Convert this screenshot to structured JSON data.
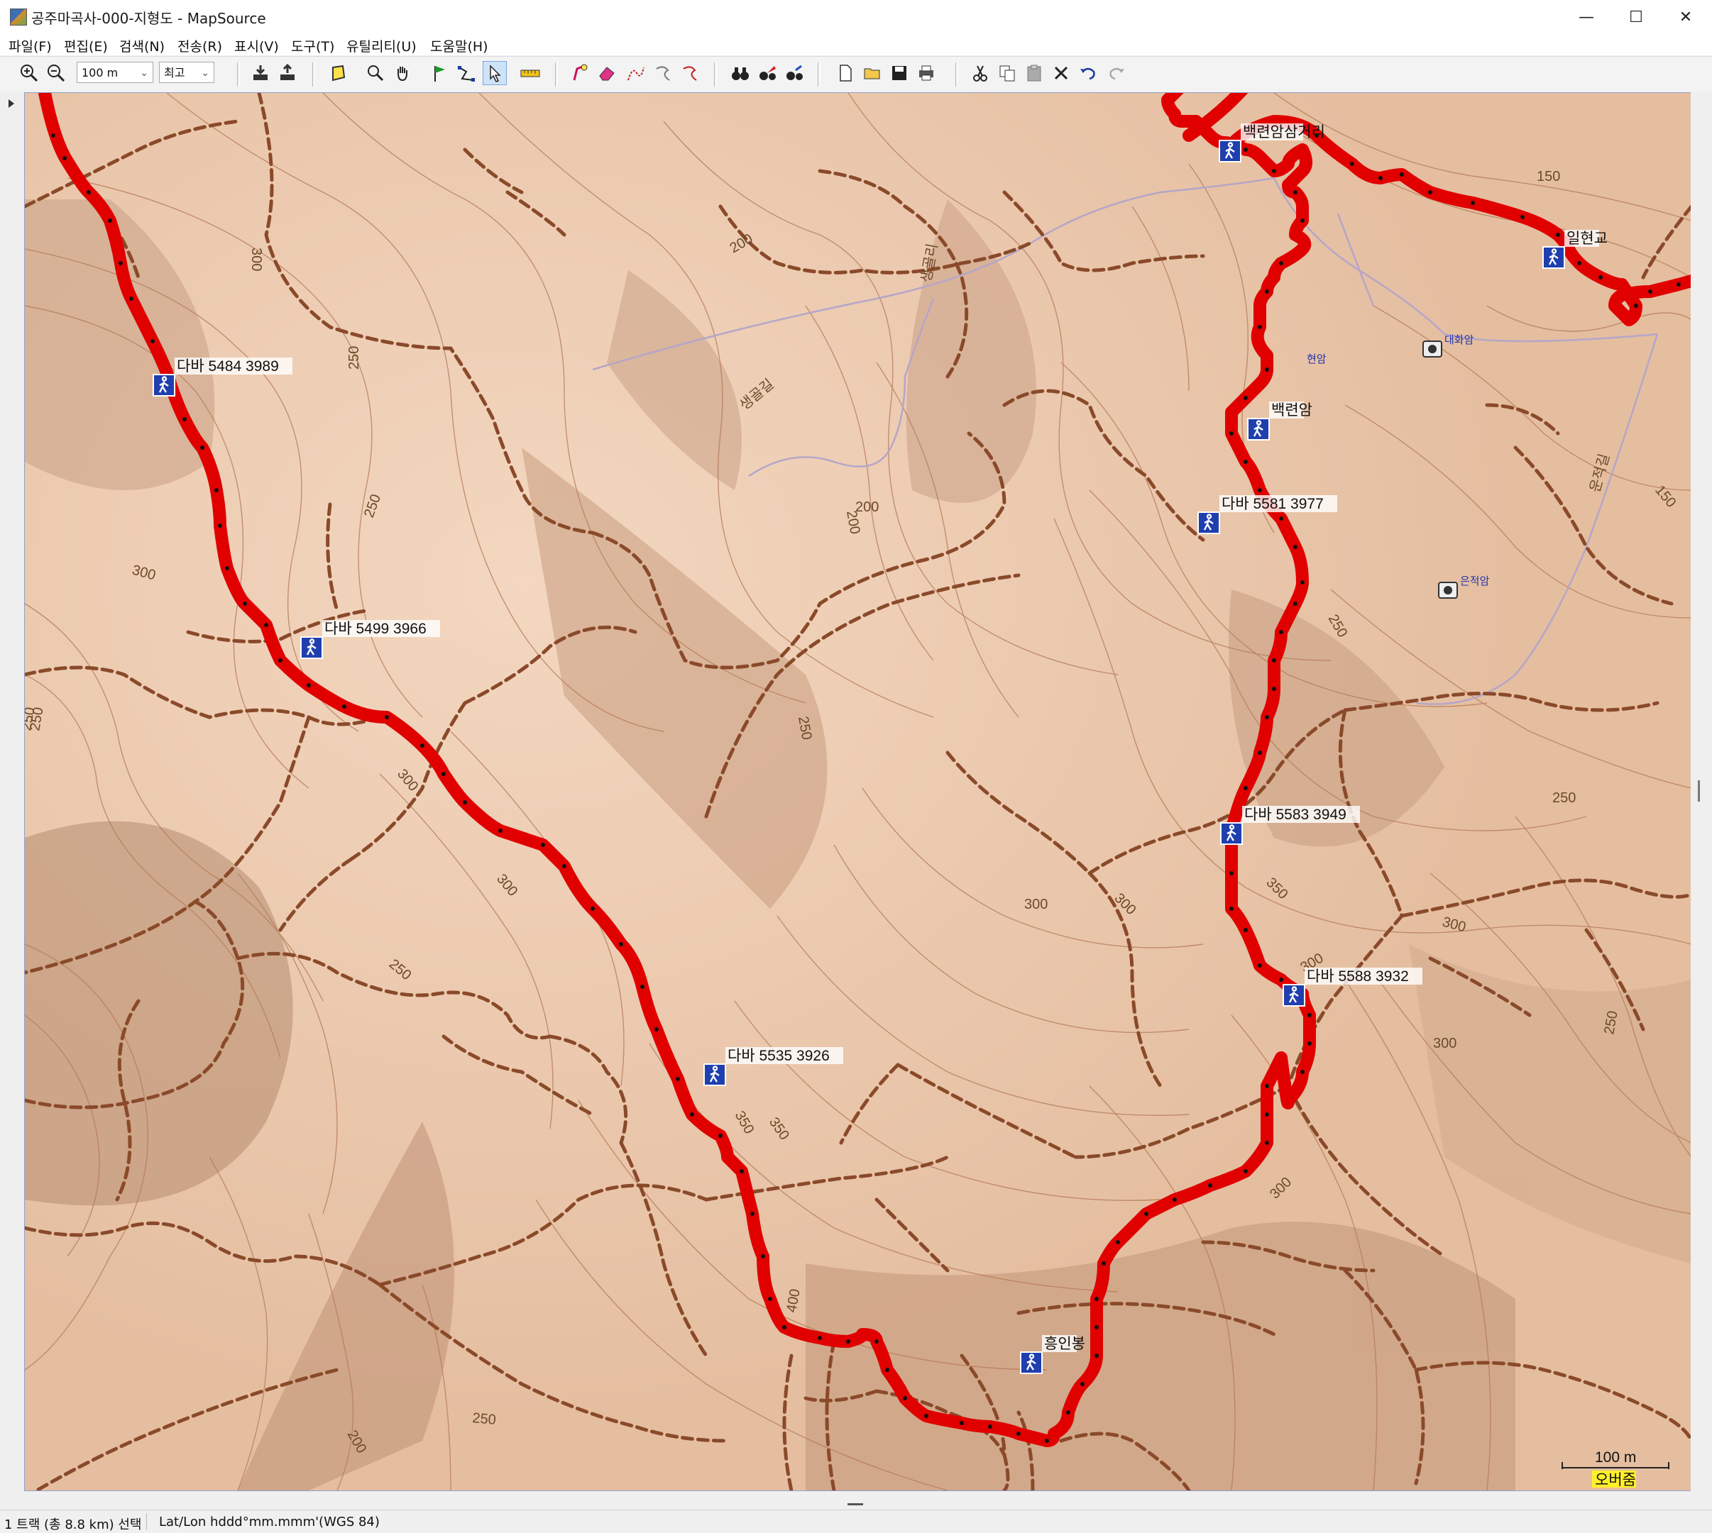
{
  "window": {
    "title": "공주마곡사-000-지형도 - MapSource",
    "minimize": "—",
    "maximize": "☐",
    "close": "✕"
  },
  "menu": [
    "파일(F)",
    "편집(E)",
    "검색(N)",
    "전송(R)",
    "표시(V)",
    "도구(T)",
    "유틸리티(U)",
    "도움말(H)"
  ],
  "toolbar": {
    "zoom_level": "100 m",
    "detail_level": "최고"
  },
  "map": {
    "waypoints": [
      {
        "label": "다바 5484 3989",
        "icon": "hiker-icon"
      },
      {
        "label": "다바 5499 3966",
        "icon": "hiker-icon"
      },
      {
        "label": "다바 5535 3926",
        "icon": "hiker-icon"
      },
      {
        "label": "흥인봉",
        "icon": "hiker-icon"
      },
      {
        "label": "다바 5588 3932",
        "icon": "hiker-icon"
      },
      {
        "label": "다바 5583 3949",
        "icon": "hiker-icon"
      },
      {
        "label": "다바 5581 3977",
        "icon": "hiker-icon"
      },
      {
        "label": "백련암",
        "icon": "hiker-icon"
      },
      {
        "label": "백련암삼거리",
        "icon": "hiker-icon"
      },
      {
        "label": "일현교",
        "icon": "hiker-icon"
      }
    ],
    "contour_labels": [
      "300",
      "250",
      "250",
      "300",
      "250",
      "300",
      "300",
      "250",
      "200",
      "250",
      "200",
      "300",
      "350",
      "300",
      "350",
      "300",
      "250",
      "300",
      "250",
      "300",
      "200",
      "250",
      "150",
      "150",
      "350",
      "250",
      "400",
      "250",
      "300",
      "200"
    ],
    "poi": [
      {
        "label": "대화암",
        "icon": "camera-icon"
      },
      {
        "label": "은적암",
        "icon": "camera-icon"
      },
      {
        "label": "현암",
        "icon": "camera-icon"
      }
    ],
    "road_labels": [
      "생골리",
      "생골길",
      "운적길"
    ],
    "scale": {
      "distance": "100 m",
      "overzoom": "오버줌"
    },
    "colors": {
      "track": "#e00000",
      "terrain": "#e9c4a8",
      "trail": "#8a4a2a",
      "contour": "#a76a48"
    }
  },
  "status": {
    "selection": "1 트랙 (총 8.8 km) 선택",
    "coords": "Lat/Lon hddd°mm.mmm'(WGS 84)"
  }
}
